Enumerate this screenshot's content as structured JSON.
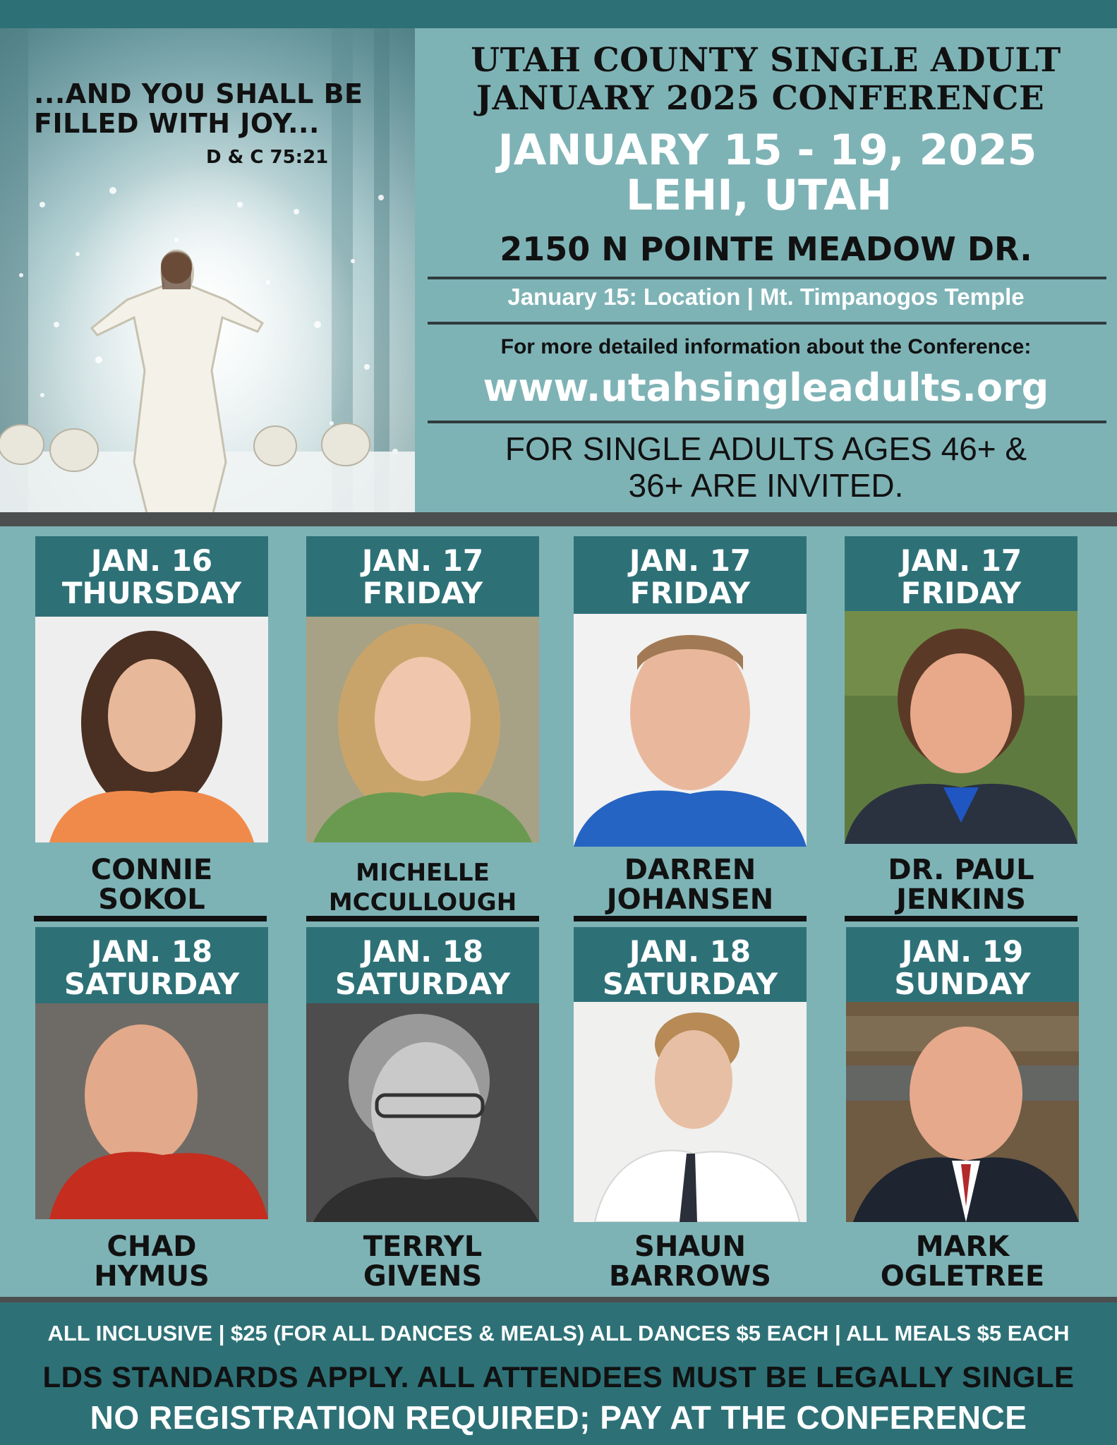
{
  "hero": {
    "quote": "...AND YOU SHALL BE FILLED WITH JOY...",
    "reference": "D & C 75:21"
  },
  "header": {
    "title_line1": "UTAH COUNTY  SINGLE ADULT",
    "title_line2": "JANUARY 2025 CONFERENCE",
    "dates": "JANUARY 15 - 19, 2025",
    "city": "LEHI, UTAH",
    "address": "2150 N POINTE MEADOW DR.",
    "location_note": "January 15: Location | Mt. Timpanogos Temple",
    "more_info": "For more detailed information about the Conference:",
    "url": "www.utahsingleadults.org",
    "ages_line1": "FOR SINGLE ADULTS AGES 46+ &",
    "ages_line2": "36+ ARE INVITED."
  },
  "speakers": [
    {
      "date": "JAN. 16",
      "day": "THURSDAY",
      "name1": "CONNIE",
      "name2": "SOKOL"
    },
    {
      "date": "JAN. 17",
      "day": "FRIDAY",
      "name1": "MICHELLE",
      "name2": "MCCULLOUGH"
    },
    {
      "date": "JAN. 17",
      "day": "FRIDAY",
      "name1": "DARREN",
      "name2": "JOHANSEN"
    },
    {
      "date": "JAN. 17",
      "day": "FRIDAY",
      "name1": "DR. PAUL",
      "name2": "JENKINS"
    },
    {
      "date": "JAN. 18",
      "day": "SATURDAY",
      "name1": "CHAD",
      "name2": "HYMUS"
    },
    {
      "date": "JAN. 18",
      "day": "SATURDAY",
      "name1": "TERRYL",
      "name2": "GIVENS"
    },
    {
      "date": "JAN. 18",
      "day": "SATURDAY",
      "name1": "SHAUN",
      "name2": "BARROWS"
    },
    {
      "date": "JAN. 19",
      "day": "SUNDAY",
      "name1": "MARK",
      "name2": "OGLETREE"
    }
  ],
  "footer": {
    "pricing": "ALL INCLUSIVE | $25 (FOR ALL DANCES & MEALS)  ALL DANCES $5 EACH | ALL MEALS $5 EACH",
    "standards": "LDS STANDARDS APPLY. ALL ATTENDEES MUST BE LEGALLY SINGLE",
    "registration": "NO REGISTRATION REQUIRED; PAY AT THE CONFERENCE"
  },
  "colors": {
    "teal_dark": "#2d7177",
    "teal_light": "#7eb3b6",
    "divider": "#4b4f50"
  }
}
